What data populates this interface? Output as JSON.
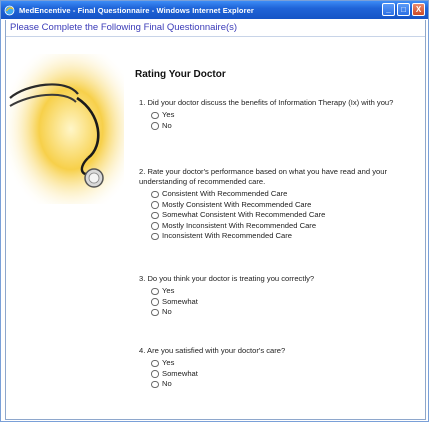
{
  "window": {
    "title": "MedEncentive - Final Questionnaire - Windows Internet Explorer",
    "icon": "ie-icon",
    "buttons": {
      "minimize": "_",
      "maximize": "□",
      "close": "X"
    }
  },
  "page": {
    "heading": "Please Complete the Following  Final Questionnaire(s)",
    "section_title": "Rating Your Doctor",
    "image": "stethoscope-image"
  },
  "questions": [
    {
      "text": "1. Did your doctor discuss the benefits of Information Therapy (Ix) with you?",
      "options": [
        "Yes",
        "No"
      ]
    },
    {
      "text": "2. Rate your doctor's performance based on what you have read and your understanding of recommended care.",
      "options": [
        "Consistent With Recommended Care",
        "Mostly Consistent With Recommended Care",
        "Somewhat Consistent With Recommended Care",
        "Mostly Inconsistent With Recommended Care",
        "Inconsistent With Recommended Care"
      ]
    },
    {
      "text": "3. Do you think your doctor is treating you correctly?",
      "options": [
        "Yes",
        "Somewhat",
        "No"
      ]
    },
    {
      "text": "4. Are you satisfied with your doctor's care?",
      "options": [
        "Yes",
        "Somewhat",
        "No"
      ]
    }
  ],
  "colors": {
    "titlebar": "#1f64d8",
    "heading_text": "#3b3bb8",
    "stethoscope_glow": "#f4c63a"
  }
}
